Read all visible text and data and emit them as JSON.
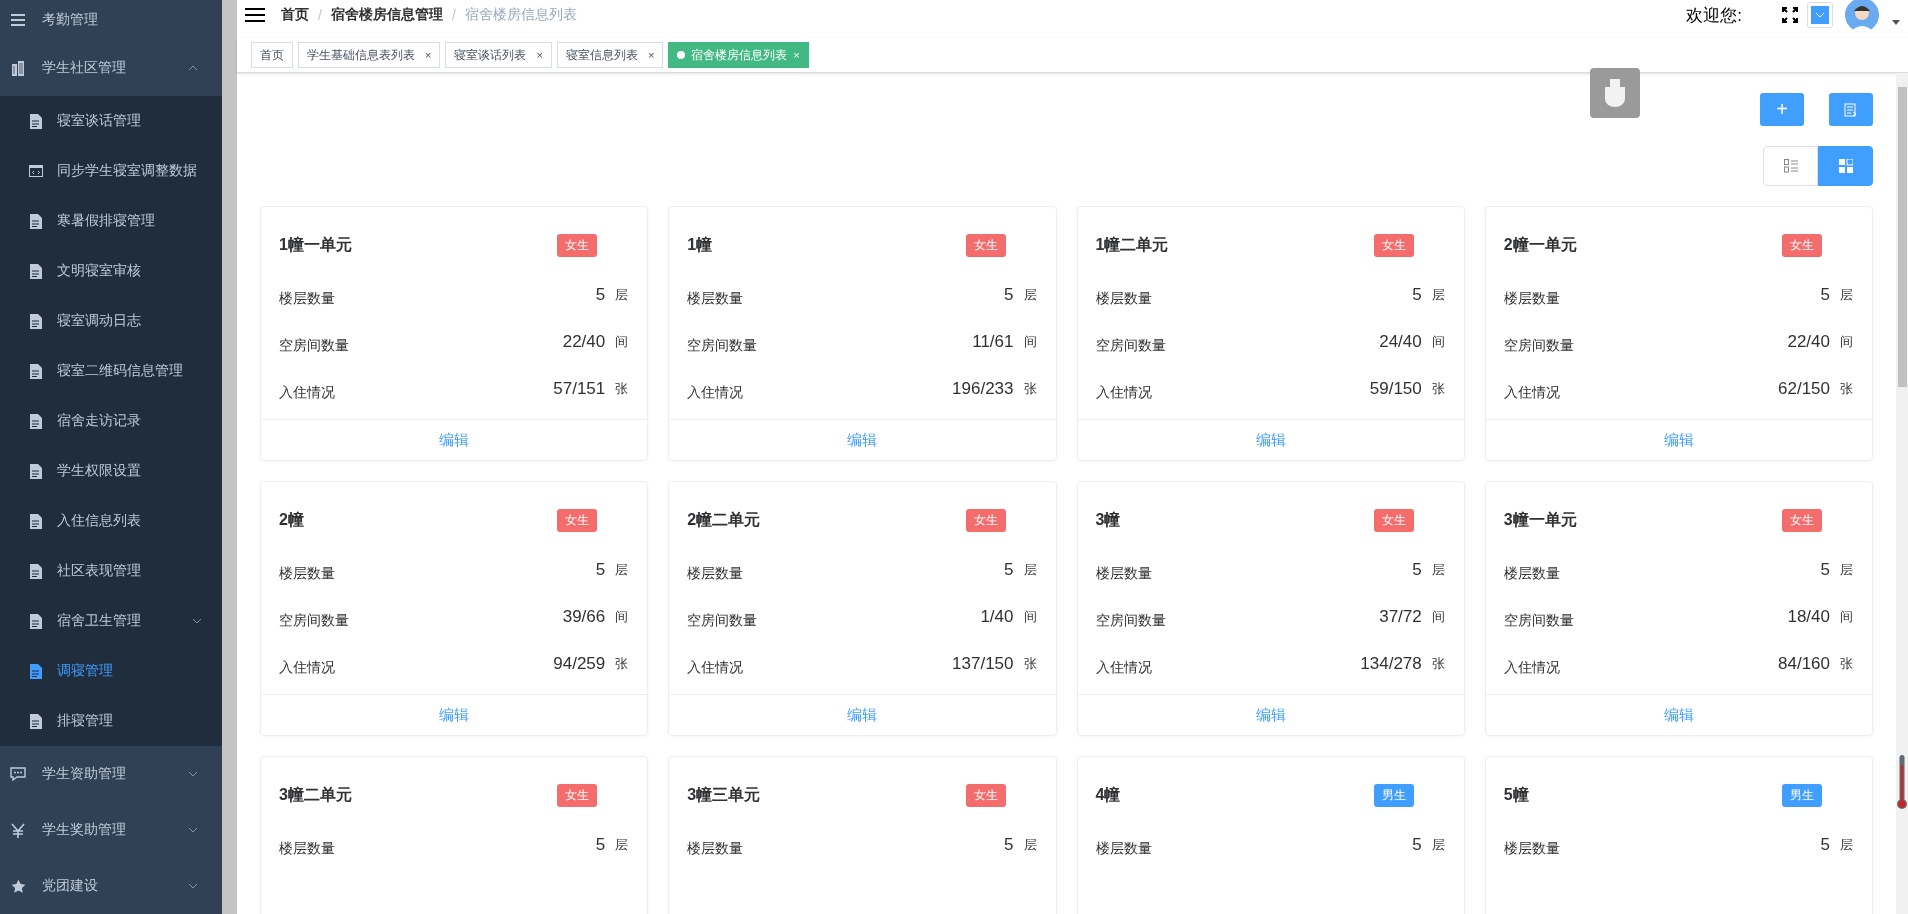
{
  "sidebar": {
    "items": [
      {
        "label": "考勤管理",
        "selected": false
      },
      {
        "label": "学生社区管理",
        "expanded": true,
        "selected": false,
        "children": [
          {
            "label": "寝室谈话管理",
            "selected": false,
            "has_children": false
          },
          {
            "label": "同步学生寝室调整数据",
            "selected": false,
            "has_children": false
          },
          {
            "label": "寒暑假排寝管理",
            "selected": false,
            "has_children": false
          },
          {
            "label": "文明寝室审核",
            "selected": false,
            "has_children": false
          },
          {
            "label": "寝室调动日志",
            "selected": false,
            "has_children": false
          },
          {
            "label": "寝室二维码信息管理",
            "selected": false,
            "has_children": false
          },
          {
            "label": "宿舍走访记录",
            "selected": false,
            "has_children": false
          },
          {
            "label": "学生权限设置",
            "selected": false,
            "has_children": false
          },
          {
            "label": "入住信息列表",
            "selected": false,
            "has_children": false
          },
          {
            "label": "社区表现管理",
            "selected": false,
            "has_children": false
          },
          {
            "label": "宿舍卫生管理",
            "selected": false,
            "has_children": true
          },
          {
            "label": "调寝管理",
            "selected": true,
            "has_children": false
          },
          {
            "label": "排寝管理",
            "selected": false,
            "has_children": false
          }
        ]
      },
      {
        "label": "学生资助管理",
        "expanded": false,
        "selected": false
      },
      {
        "label": "学生奖助管理",
        "expanded": false,
        "selected": false
      },
      {
        "label": "党团建设",
        "expanded": false,
        "selected": false
      }
    ]
  },
  "breadcrumb": {
    "separator": "/",
    "items": [
      "首页",
      "宿舍楼房信息管理",
      "宿舍楼房信息列表"
    ]
  },
  "header": {
    "welcome": "欢迎您:"
  },
  "tabs": [
    {
      "label": "首页",
      "selected": false
    },
    {
      "label": "学生基础信息表列表",
      "selected": false,
      "close": "×"
    },
    {
      "label": "寝室谈话列表",
      "selected": false,
      "close": "×"
    },
    {
      "label": "寝室信息列表",
      "selected": false,
      "close": "×"
    },
    {
      "label": "宿舍楼房信息列表",
      "selected": true,
      "close": "×"
    }
  ],
  "toolbar": {
    "add": "+"
  },
  "view_toggle": [
    {
      "kind": "list",
      "selected": false
    },
    {
      "kind": "card",
      "selected": true
    }
  ],
  "buildings": [
    {
      "name": "1幢一单元",
      "tag": "女生",
      "color": "#f56c6c",
      "stats": [
        {
          "label": "楼层数量",
          "value": "5",
          "unit": "层"
        },
        {
          "label": "空房间数量",
          "value": "22/40",
          "unit": "间"
        },
        {
          "label": "入住情况",
          "value": "57/151",
          "unit": "张"
        }
      ],
      "action": "编辑"
    },
    {
      "name": "1幢",
      "tag": "女生",
      "color": "#f56c6c",
      "stats": [
        {
          "label": "楼层数量",
          "value": "5",
          "unit": "层"
        },
        {
          "label": "空房间数量",
          "value": "11/61",
          "unit": "间"
        },
        {
          "label": "入住情况",
          "value": "196/233",
          "unit": "张"
        }
      ],
      "action": "编辑"
    },
    {
      "name": "1幢二单元",
      "tag": "女生",
      "color": "#f56c6c",
      "stats": [
        {
          "label": "楼层数量",
          "value": "5",
          "unit": "层"
        },
        {
          "label": "空房间数量",
          "value": "24/40",
          "unit": "间"
        },
        {
          "label": "入住情况",
          "value": "59/150",
          "unit": "张"
        }
      ],
      "action": "编辑"
    },
    {
      "name": "2幢一单元",
      "tag": "女生",
      "color": "#f56c6c",
      "stats": [
        {
          "label": "楼层数量",
          "value": "5",
          "unit": "层"
        },
        {
          "label": "空房间数量",
          "value": "22/40",
          "unit": "间"
        },
        {
          "label": "入住情况",
          "value": "62/150",
          "unit": "张"
        }
      ],
      "action": "编辑"
    },
    {
      "name": "2幢",
      "tag": "女生",
      "color": "#f56c6c",
      "stats": [
        {
          "label": "楼层数量",
          "value": "5",
          "unit": "层"
        },
        {
          "label": "空房间数量",
          "value": "39/66",
          "unit": "间"
        },
        {
          "label": "入住情况",
          "value": "94/259",
          "unit": "张"
        }
      ],
      "action": "编辑"
    },
    {
      "name": "2幢二单元",
      "tag": "女生",
      "color": "#f56c6c",
      "stats": [
        {
          "label": "楼层数量",
          "value": "5",
          "unit": "层"
        },
        {
          "label": "空房间数量",
          "value": "1/40",
          "unit": "间"
        },
        {
          "label": "入住情况",
          "value": "137/150",
          "unit": "张"
        }
      ],
      "action": "编辑"
    },
    {
      "name": "3幢",
      "tag": "女生",
      "color": "#f56c6c",
      "stats": [
        {
          "label": "楼层数量",
          "value": "5",
          "unit": "层"
        },
        {
          "label": "空房间数量",
          "value": "37/72",
          "unit": "间"
        },
        {
          "label": "入住情况",
          "value": "134/278",
          "unit": "张"
        }
      ],
      "action": "编辑"
    },
    {
      "name": "3幢一单元",
      "tag": "女生",
      "color": "#f56c6c",
      "stats": [
        {
          "label": "楼层数量",
          "value": "5",
          "unit": "层"
        },
        {
          "label": "空房间数量",
          "value": "18/40",
          "unit": "间"
        },
        {
          "label": "入住情况",
          "value": "84/160",
          "unit": "张"
        }
      ],
      "action": "编辑"
    },
    {
      "name": "3幢二单元",
      "tag": "女生",
      "color": "#f56c6c",
      "stats": [
        {
          "label": "楼层数量",
          "value": "5",
          "unit": "层"
        }
      ]
    },
    {
      "name": "3幢三单元",
      "tag": "女生",
      "color": "#f56c6c",
      "stats": [
        {
          "label": "楼层数量",
          "value": "5",
          "unit": "层"
        }
      ]
    },
    {
      "name": "4幢",
      "tag": "男生",
      "color": "#409eff",
      "stats": [
        {
          "label": "楼层数量",
          "value": "5",
          "unit": "层"
        }
      ]
    },
    {
      "name": "5幢",
      "tag": "男生",
      "color": "#409eff",
      "stats": [
        {
          "label": "楼层数量",
          "value": "5",
          "unit": "层"
        }
      ]
    }
  ]
}
